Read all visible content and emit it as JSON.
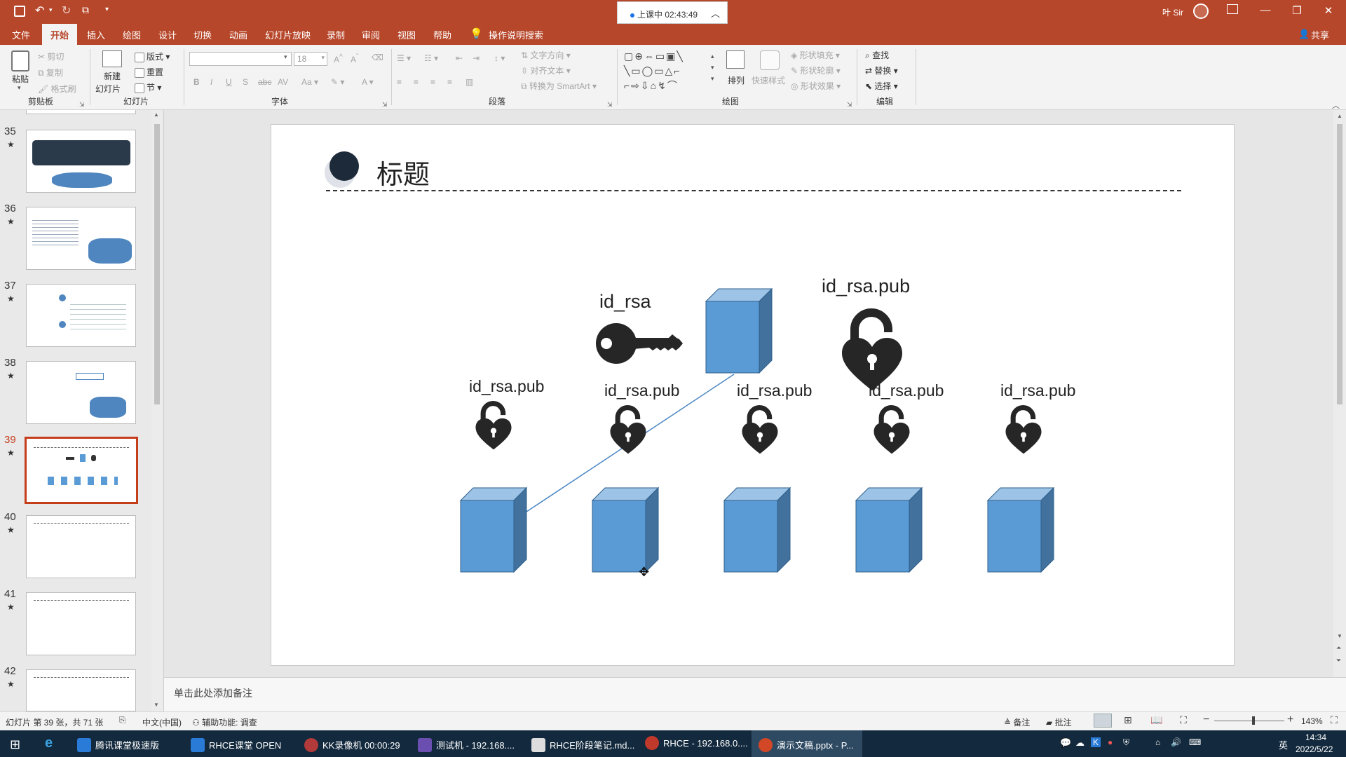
{
  "titlebar": {
    "recording_badge": "上课中 02:43:49",
    "user_name": "叶 Sir",
    "minimize": "—",
    "restore": "❐",
    "close": "✕"
  },
  "ribbon_tabs": [
    {
      "label": "文件"
    },
    {
      "label": "开始"
    },
    {
      "label": "插入"
    },
    {
      "label": "绘图"
    },
    {
      "label": "设计"
    },
    {
      "label": "切换"
    },
    {
      "label": "动画"
    },
    {
      "label": "幻灯片放映"
    },
    {
      "label": "录制"
    },
    {
      "label": "审阅"
    },
    {
      "label": "视图"
    },
    {
      "label": "帮助"
    },
    {
      "label": "操作说明搜索"
    }
  ],
  "share_label": "共享",
  "ribbon": {
    "clipboard": {
      "paste": "粘贴",
      "cut": "剪切",
      "copy": "复制",
      "format_painter": "格式刷",
      "group": "剪贴板"
    },
    "slides": {
      "new_slide_1": "新建",
      "new_slide_2": "幻灯片",
      "layout": "版式",
      "reset": "重置",
      "section": "节",
      "group": "幻灯片"
    },
    "font": {
      "size": "18",
      "group": "字体"
    },
    "paragraph": {
      "text_direction": "文字方向",
      "align_text": "对齐文本",
      "smartart": "转换为 SmartArt",
      "group": "段落"
    },
    "drawing": {
      "arrange": "排列",
      "quick_styles": "快速样式",
      "shape_fill": "形状填充",
      "shape_outline": "形状轮廓",
      "shape_effects": "形状效果",
      "group": "绘图"
    },
    "editing": {
      "find": "查找",
      "replace": "替换",
      "select": "选择",
      "group": "编辑"
    }
  },
  "thumbnails": [
    {
      "number": "35",
      "star": "★"
    },
    {
      "number": "36",
      "star": "★"
    },
    {
      "number": "37",
      "star": "★"
    },
    {
      "number": "38",
      "star": "★"
    },
    {
      "number": "39",
      "star": "★"
    },
    {
      "number": "40",
      "star": "★"
    },
    {
      "number": "41",
      "star": "★"
    },
    {
      "number": "42",
      "star": "★"
    }
  ],
  "slide": {
    "title": "标题",
    "private_key_label": "id_rsa",
    "public_key_label": "id_rsa.pub",
    "server_labels": [
      "id_rsa.pub",
      "id_rsa.pub",
      "id_rsa.pub",
      "id_rsa.pub",
      "id_rsa.pub"
    ]
  },
  "notes_placeholder": "单击此处添加备注",
  "status": {
    "slide_info": "幻灯片 第 39 张，共 71 张",
    "language": "中文(中国)",
    "accessibility": "辅助功能: 调查",
    "notes": "备注",
    "comments": "批注",
    "zoom": "143%"
  },
  "taskbar": {
    "items": [
      {
        "label": "腾讯课堂极速版"
      },
      {
        "label": "RHCE课堂 OPEN"
      },
      {
        "label": "KK录像机 00:00:29"
      },
      {
        "label": "测试机 - 192.168...."
      },
      {
        "label": "RHCE阶段笔记.md..."
      },
      {
        "label": "RHCE - 192.168.0...."
      },
      {
        "label": "演示文稿.pptx - P..."
      }
    ],
    "ime": "英",
    "time": "14:34",
    "date": "2022/5/22"
  },
  "colors": {
    "accent": "#b7472a",
    "cube_front": "#5b9bd5",
    "cube_side": "#41719c",
    "connector": "#4a86c5",
    "icon_dark": "#262626"
  }
}
